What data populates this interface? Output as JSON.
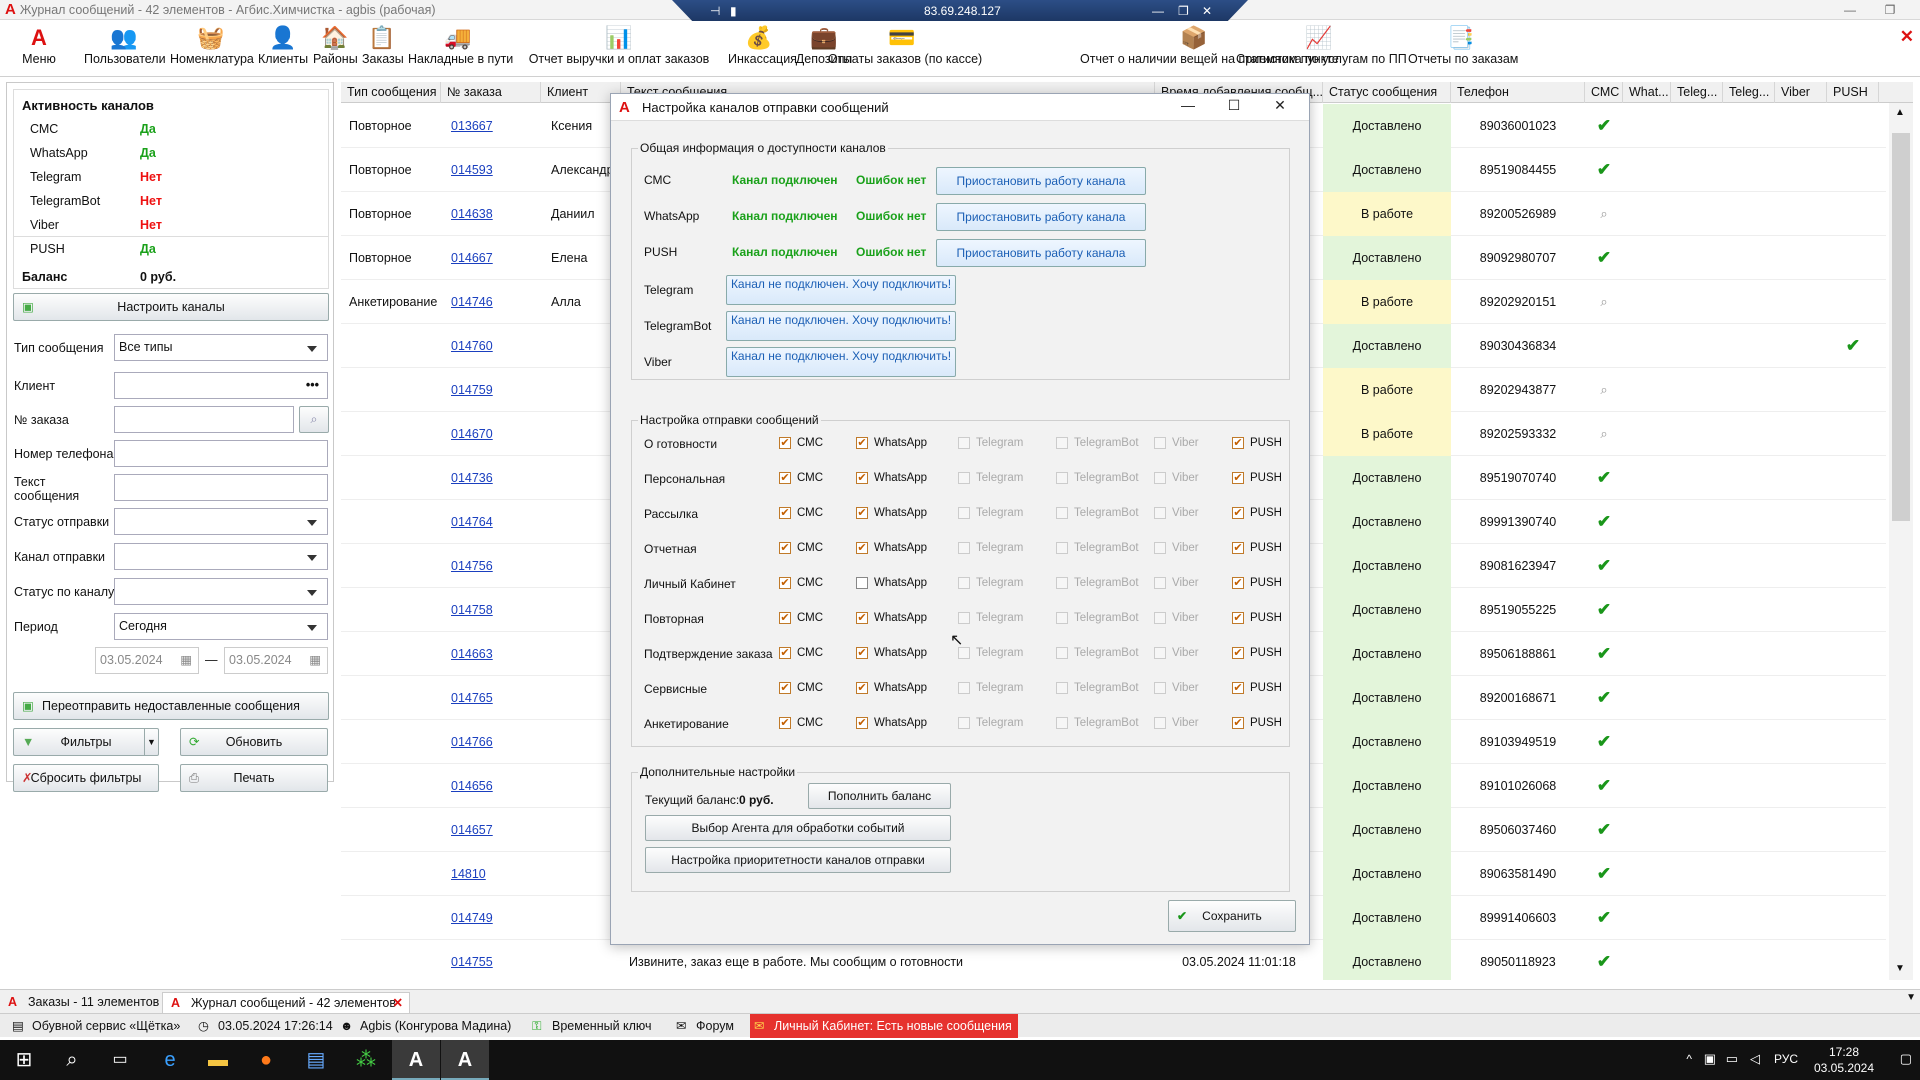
{
  "window": {
    "title": "Журнал сообщений - 42 элементов - Агбис.Химчистка - agbis (рабочая)"
  },
  "rdp": {
    "ip": "83.69.248.127"
  },
  "toolbar": {
    "menu": "Меню",
    "items": [
      "Пользователи",
      "Номенклатура",
      "Клиенты",
      "Районы",
      "Заказы",
      "Накладные в пути",
      "Отчет выручки и оплат заказов",
      "Инкассация",
      "Депозиты",
      "Оплаты заказов (по кассе)",
      "Отчет о наличии вещей на приемном пункте",
      "Статистика по услугам по ПП",
      "Отчеты по заказам"
    ]
  },
  "left": {
    "title": "Активность каналов",
    "channels": [
      {
        "name": "СМС",
        "value": "Да"
      },
      {
        "name": "WhatsApp",
        "value": "Да"
      },
      {
        "name": "Telegram",
        "value": "Нет"
      },
      {
        "name": "TelegramBot",
        "value": "Нет"
      },
      {
        "name": "Viber",
        "value": "Нет"
      },
      {
        "name": "PUSH",
        "value": "Да"
      }
    ],
    "balance_label": "Баланс",
    "balance_value": "0 руб.",
    "configure_btn": "Настроить каналы",
    "filters": {
      "msg_type_label": "Тип сообщения",
      "msg_type_value": "Все типы",
      "client_label": "Клиент",
      "order_label": "№ заказа",
      "phone_label": "Номер телефона",
      "text_label": "Текст сообщения",
      "send_status_label": "Статус отправки",
      "channel_label": "Канал отправки",
      "channel_status_label": "Статус по каналу",
      "period_label": "Период",
      "period_value": "Сегодня",
      "date_from": "03.05.2024",
      "date_to": "03.05.2024",
      "date_dash": "—"
    },
    "resend_btn": "Переотправить недоставленные сообщения",
    "filters_btn": "Фильтры",
    "refresh_btn": "Обновить",
    "reset_btn": "Сбросить фильтры",
    "print_btn": "Печать"
  },
  "grid": {
    "headers": [
      "Тип сообщения",
      "№ заказа",
      "Клиент",
      "Текст сообщения",
      "Время добавления сообщ...",
      "Статус сообщения",
      "Телефон",
      "СМС",
      "What...",
      "Teleg...",
      "Teleg...",
      "Viber",
      "PUSH"
    ],
    "rows": [
      {
        "type": "Повторное",
        "order": "013667",
        "client": "Ксения",
        "status": "Доставлено",
        "phone": "89036001023",
        "sms": "check"
      },
      {
        "type": "Повторное",
        "order": "014593",
        "client": "Александр",
        "status": "Доставлено",
        "phone": "89519084455",
        "sms": "check"
      },
      {
        "type": "Повторное",
        "order": "014638",
        "client": "Даниил",
        "status": "В работе",
        "phone": "89200526989",
        "sms": "search"
      },
      {
        "type": "Повторное",
        "order": "014667",
        "client": "Елена",
        "status": "Доставлено",
        "phone": "89092980707",
        "sms": "check"
      },
      {
        "type": "Анкетирование",
        "order": "014746",
        "client": "Алла",
        "status": "В работе",
        "phone": "89202920151",
        "sms": "search"
      },
      {
        "type": "",
        "order": "014760",
        "client": "",
        "status": "Доставлено",
        "phone": "89030436834",
        "sms": "",
        "push": "check"
      },
      {
        "type": "",
        "order": "014759",
        "client": "",
        "status": "В работе",
        "phone": "89202943877",
        "sms": "search"
      },
      {
        "type": "",
        "order": "014670",
        "client": "",
        "status": "В работе",
        "phone": "89202593332",
        "sms": "search"
      },
      {
        "type": "",
        "order": "014736",
        "client": "",
        "status": "Доставлено",
        "phone": "89519070740",
        "sms": "check"
      },
      {
        "type": "",
        "order": "014764",
        "client": "",
        "status": "Доставлено",
        "phone": "89991390740",
        "sms": "check"
      },
      {
        "type": "",
        "order": "014756",
        "client": "",
        "status": "Доставлено",
        "phone": "89081623947",
        "sms": "check"
      },
      {
        "type": "",
        "order": "014758",
        "client": "",
        "status": "Доставлено",
        "phone": "89519055225",
        "sms": "check"
      },
      {
        "type": "",
        "order": "014663",
        "client": "",
        "status": "Доставлено",
        "phone": "89506188861",
        "sms": "check"
      },
      {
        "type": "",
        "order": "014765",
        "client": "",
        "status": "Доставлено",
        "phone": "89200168671",
        "sms": "check"
      },
      {
        "type": "",
        "order": "014766",
        "client": "",
        "status": "Доставлено",
        "phone": "89103949519",
        "sms": "check"
      },
      {
        "type": "",
        "order": "014656",
        "client": "",
        "status": "Доставлено",
        "phone": "89101026068",
        "sms": "check"
      },
      {
        "type": "",
        "order": "014657",
        "client": "",
        "status": "Доставлено",
        "phone": "89506037460",
        "sms": "check"
      },
      {
        "type": "",
        "order": "14810",
        "client": "",
        "status": "Доставлено",
        "phone": "89063581490",
        "sms": "check"
      },
      {
        "type": "",
        "order": "014749",
        "client": "",
        "status": "Доставлено",
        "phone": "89991406603",
        "sms": "check"
      },
      {
        "type": "",
        "order": "014755",
        "client": "",
        "text": "Извините, заказ еще в работе. Мы сообщим о готовности",
        "time": "03.05.2024 11:01:18",
        "status": "Доставлено",
        "phone": "89050118923",
        "sms": "check"
      }
    ]
  },
  "dialog": {
    "title": "Настройка каналов отправки сообщений",
    "avail_group": "Общая информация о доступности каналов",
    "connected": [
      {
        "name": "СМС",
        "state": "Канал подключен",
        "errors": "Ошибок нет",
        "btn": "Приостановить работу канала"
      },
      {
        "name": "WhatsApp",
        "state": "Канал подключен",
        "errors": "Ошибок нет",
        "btn": "Приостановить работу канала"
      },
      {
        "name": "PUSH",
        "state": "Канал подключен",
        "errors": "Ошибок нет",
        "btn": "Приостановить работу канала"
      }
    ],
    "disconnected": [
      {
        "name": "Telegram",
        "btn": "Канал не подключен. Хочу подключить!"
      },
      {
        "name": "TelegramBot",
        "btn": "Канал не подключен. Хочу подключить!"
      },
      {
        "name": "Viber",
        "btn": "Канал не подключен. Хочу подключить!"
      }
    ],
    "send_group": "Настройка отправки сообщений",
    "channel_names": [
      "СМС",
      "WhatsApp",
      "Telegram",
      "TelegramBot",
      "Viber",
      "PUSH"
    ],
    "send_rows": [
      {
        "name": "О готовности",
        "checks": [
          true,
          true,
          false,
          false,
          false,
          true
        ]
      },
      {
        "name": "Персональная",
        "checks": [
          true,
          true,
          false,
          false,
          false,
          true
        ]
      },
      {
        "name": "Рассылка",
        "checks": [
          true,
          true,
          false,
          false,
          false,
          true
        ]
      },
      {
        "name": "Отчетная",
        "checks": [
          true,
          true,
          false,
          false,
          false,
          true
        ]
      },
      {
        "name": "Личный Кабинет",
        "checks": [
          true,
          false,
          false,
          false,
          false,
          true
        ]
      },
      {
        "name": "Повторная",
        "checks": [
          true,
          true,
          false,
          false,
          false,
          true
        ]
      },
      {
        "name": "Подтверждение заказа",
        "checks": [
          true,
          true,
          false,
          false,
          false,
          true
        ]
      },
      {
        "name": "Сервисные",
        "checks": [
          true,
          true,
          false,
          false,
          false,
          true
        ]
      },
      {
        "name": "Анкетирование",
        "checks": [
          true,
          true,
          false,
          false,
          false,
          true
        ]
      }
    ],
    "extra_group": "Дополнительные настройки",
    "balance_label": "Текущий баланс:",
    "balance_value": "0 руб.",
    "topup_btn": "Пополнить баланс",
    "agent_btn": "Выбор Агента для обработки событий",
    "priority_btn": "Настройка приоритетности каналов отправки",
    "save_btn": "Сохранить"
  },
  "tabs": [
    {
      "label": "Заказы - 11 элементов"
    },
    {
      "label": "Журнал сообщений - 42 элементов"
    }
  ],
  "status": {
    "org": "Обувной сервис «Щётка»",
    "datetime": "03.05.2024 17:26:14",
    "user": "Agbis (Конгурова Мадина)",
    "key": "Временный ключ",
    "forum": "Форум",
    "lk": "Личный Кабинет: Есть новые сообщения"
  },
  "taskbar": {
    "lang": "РУС",
    "time": "17:28",
    "date": "03.05.2024"
  }
}
